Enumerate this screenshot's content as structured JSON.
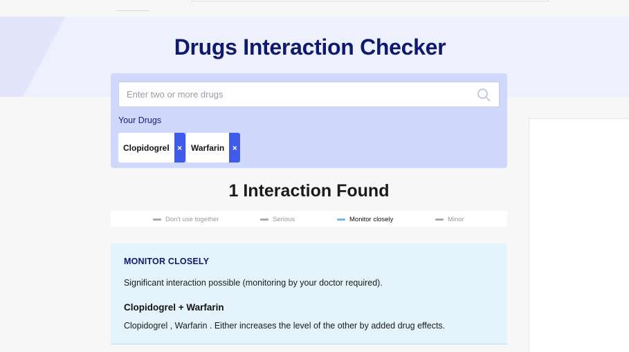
{
  "page": {
    "title": "Drugs Interaction Checker"
  },
  "search": {
    "placeholder": "Enter two or more drugs",
    "icon": "search-icon"
  },
  "your_drugs": {
    "label": "Your Drugs",
    "items": [
      {
        "name": "Clopidogrel",
        "remove": "×"
      },
      {
        "name": "Warfarin",
        "remove": "×"
      }
    ]
  },
  "results": {
    "heading": "1 Interaction Found",
    "legend": [
      {
        "label": "Don't use together",
        "active": false
      },
      {
        "label": "Serious",
        "active": false
      },
      {
        "label": "Monitor closely",
        "active": true
      },
      {
        "label": "Minor",
        "active": false
      }
    ]
  },
  "interaction": {
    "severity": "MONITOR CLOSELY",
    "description": "Significant interaction possible (monitoring by your doctor required).",
    "pair": "Clopidogrel + Warfarin",
    "detail": "Clopidogrel , Warfarin . Either increases the level of the other by added drug effects."
  },
  "colors": {
    "brand_navy": "#0d1a6e",
    "chip_remove": "#3f5be8",
    "monitor_accent": "#6fb6f2",
    "card_bg": "#e4f3fc"
  }
}
